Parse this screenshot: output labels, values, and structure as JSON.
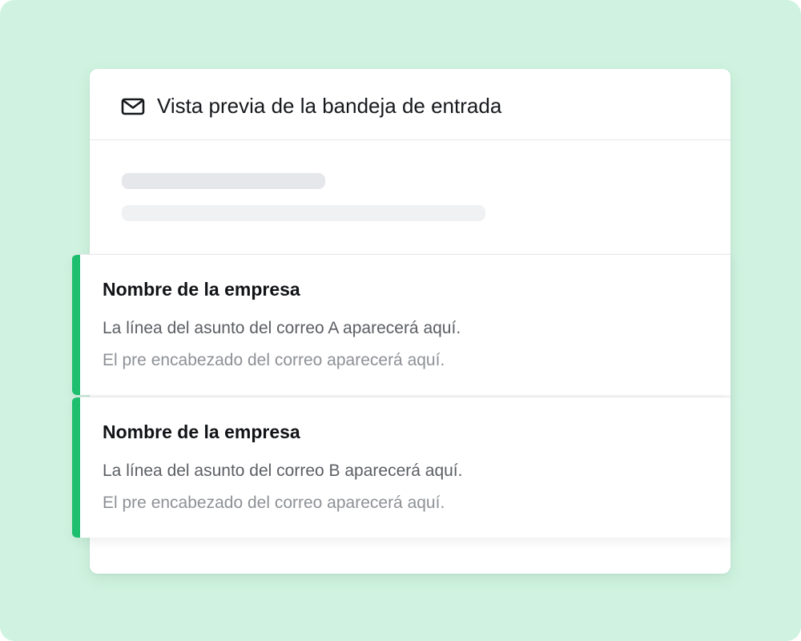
{
  "colors": {
    "background": "#cff3e0",
    "accent": "#1dbf6f",
    "card": "#ffffff"
  },
  "header": {
    "icon": "mail-icon",
    "title": "Vista previa de la bandeja de entrada"
  },
  "emails": [
    {
      "sender": "Nombre de la empresa",
      "subject": "La línea del asunto del correo A aparecerá aquí.",
      "preheader": "El pre encabezado del correo aparecerá aquí."
    },
    {
      "sender": "Nombre de la empresa",
      "subject": "La línea del asunto del correo B aparecerá aquí.",
      "preheader": "El pre encabezado del correo aparecerá aquí."
    }
  ]
}
